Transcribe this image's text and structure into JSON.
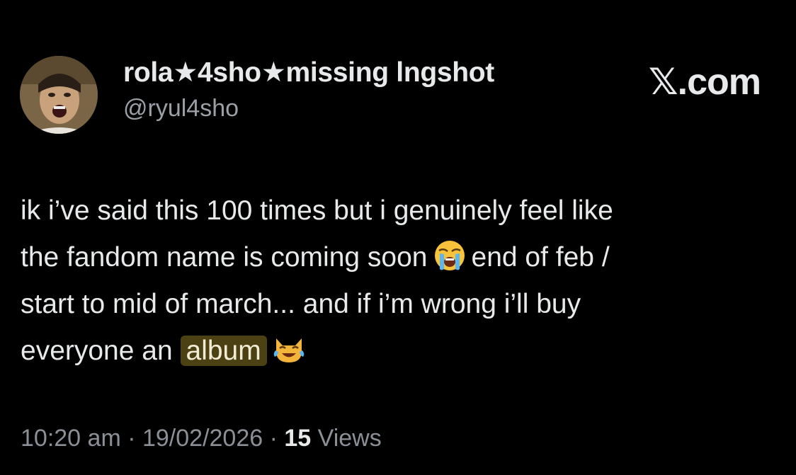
{
  "user": {
    "display_name": "rola★4sho★missing lngshot",
    "handle": "@ryul4sho"
  },
  "brand": {
    "label": "𝕏.com"
  },
  "tweet": {
    "line1": "ik i’ve said this 100 times but i genuinely feel like",
    "line2_before": "the fandom name is coming soon",
    "emoji_crying": "loudly-crying-face-emoji",
    "line2_after": "end of feb /",
    "line3": "start to mid of march... and if i’m wrong i’ll buy",
    "line4_before": "everyone an",
    "highlighted_word": "album",
    "emoji_cat": "cat-with-tears-of-joy-emoji"
  },
  "meta": {
    "time": "10:20 am",
    "sep1": " · ",
    "date": "19/02/2026",
    "sep2": " · ",
    "views_count": "15",
    "views_label": " Views"
  },
  "colors": {
    "background": "#000000",
    "text": "#e7e9ea",
    "secondary_text": "#8b9096",
    "highlight": "#4b4113"
  }
}
